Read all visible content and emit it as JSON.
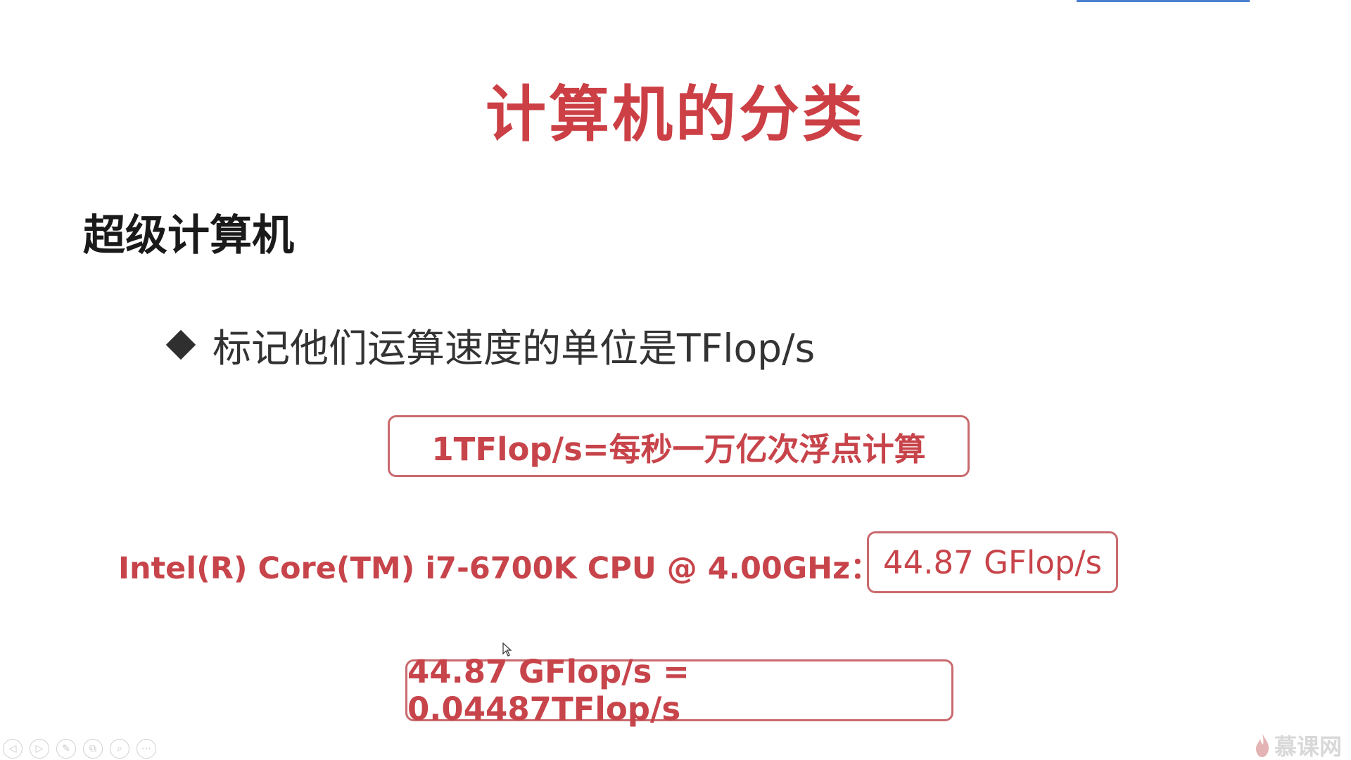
{
  "slide": {
    "title": "计算机的分类",
    "section_heading": "超级计算机",
    "bullet": "标记他们运算速度的单位是TFlop/s",
    "definition_box": "1TFlop/s=每秒一万亿次浮点计算",
    "cpu_label": "Intel(R) Core(TM) i7-6700K CPU @ 4.00GHz：",
    "cpu_value": "44.87 GFlop/s",
    "conversion_box": "44.87 GFlop/s = 0.04487TFlop/s"
  },
  "toolbar": {
    "buttons": [
      {
        "icon": "prev-icon",
        "glyph": "◁"
      },
      {
        "icon": "next-icon",
        "glyph": "▷"
      },
      {
        "icon": "pen-icon",
        "glyph": "✎"
      },
      {
        "icon": "copy-icon",
        "glyph": "⧉"
      },
      {
        "icon": "zoom-icon",
        "glyph": "⌕"
      },
      {
        "icon": "more-icon",
        "glyph": "⋯"
      }
    ]
  },
  "watermark": {
    "text": "慕课网"
  },
  "colors": {
    "title_red": "#cc3f45",
    "box_border": "#c96a6e",
    "accent_blue": "#4a7fd0"
  }
}
